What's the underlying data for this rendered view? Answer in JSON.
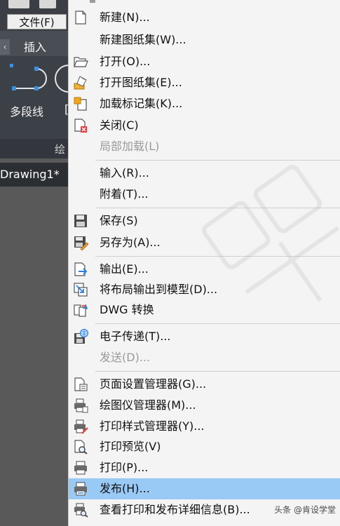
{
  "background": {
    "file_menu_label": "文件(F)",
    "ribbon_tab_insert": "插入",
    "tool_polyline": "多段线",
    "tool_partial": "[",
    "panel_label": "绘",
    "doc_tab": "Drawing1*"
  },
  "menu": {
    "items": [
      {
        "label": "新建(N)...",
        "icon": "new-file-icon"
      },
      {
        "label": "新建图纸集(W)...",
        "icon": "none"
      },
      {
        "label": "打开(O)...",
        "icon": "open-folder-icon"
      },
      {
        "label": "打开图纸集(E)...",
        "icon": "open-sheet-set-icon"
      },
      {
        "label": "加载标记集(K)...",
        "icon": "markup-set-icon"
      },
      {
        "label": "关闭(C)",
        "icon": "close-file-icon"
      },
      {
        "label": "局部加载(L)",
        "icon": "none"
      },
      {
        "label": "输入(R)...",
        "icon": "none"
      },
      {
        "label": "附着(T)...",
        "icon": "none"
      },
      {
        "label": "保存(S)",
        "icon": "save-icon"
      },
      {
        "label": "另存为(A)...",
        "icon": "save-as-icon"
      },
      {
        "label": "输出(E)...",
        "icon": "export-icon"
      },
      {
        "label": "将布局输出到模型(D)...",
        "icon": "layout-to-model-icon"
      },
      {
        "label": "DWG 转换",
        "icon": "dwg-convert-icon"
      },
      {
        "label": "电子传递(T)...",
        "icon": "etransmit-icon"
      },
      {
        "label": "发送(D)...",
        "icon": "none"
      },
      {
        "label": "页面设置管理器(G)...",
        "icon": "page-setup-icon"
      },
      {
        "label": "绘图仪管理器(M)...",
        "icon": "plotter-manager-icon"
      },
      {
        "label": "打印样式管理器(Y)...",
        "icon": "plot-style-icon"
      },
      {
        "label": "打印预览(V)",
        "icon": "plot-preview-icon"
      },
      {
        "label": "打印(P)...",
        "icon": "print-icon"
      },
      {
        "label": "发布(H)...",
        "icon": "publish-icon"
      },
      {
        "label": "查看打印和发布详细信息(B)...",
        "icon": "plot-details-icon"
      }
    ]
  },
  "footer_tag": "头条 @肯设学堂",
  "colors": {
    "highlight": "#99c9f5",
    "menu_bg": "#f4f4f4",
    "disabled_text": "#9a9a9a",
    "app_dark": "#3c4148"
  }
}
